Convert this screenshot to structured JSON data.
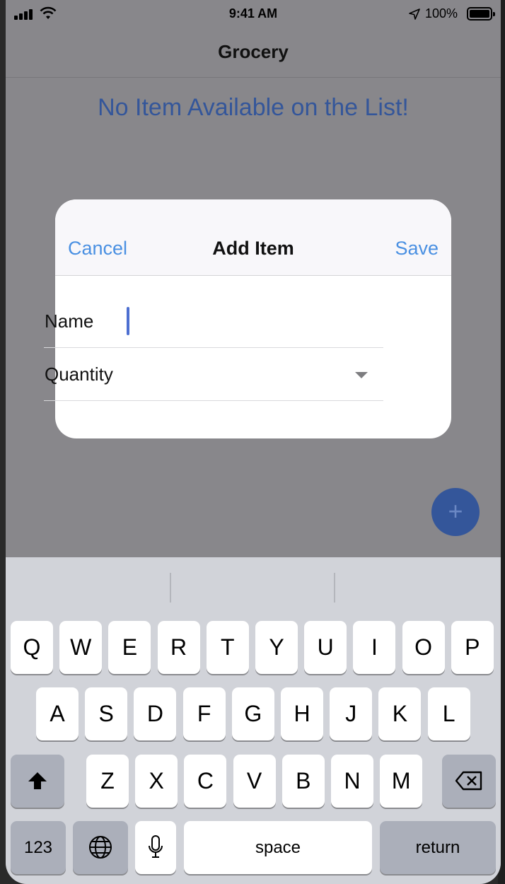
{
  "status_bar": {
    "time": "9:41 AM",
    "battery_percent": "100%"
  },
  "nav": {
    "title": "Grocery"
  },
  "empty_message": "No Item Available on the List!",
  "fab": {
    "label": "+"
  },
  "modal": {
    "cancel": "Cancel",
    "title": "Add Item",
    "save": "Save",
    "fields": {
      "name_label": "Name",
      "name_value": "",
      "quantity_label": "Quantity"
    }
  },
  "keyboard": {
    "row1": [
      "Q",
      "W",
      "E",
      "R",
      "T",
      "Y",
      "U",
      "I",
      "O",
      "P"
    ],
    "row2": [
      "A",
      "S",
      "D",
      "F",
      "G",
      "H",
      "J",
      "K",
      "L"
    ],
    "row3": [
      "Z",
      "X",
      "C",
      "V",
      "B",
      "N",
      "M"
    ],
    "numbers_key": "123",
    "space_key": "space",
    "return_key": "return"
  },
  "colors": {
    "accent": "#4a90e2",
    "message": "#34569a",
    "overlay": "#88878b",
    "keyboard_bg": "#d1d3d9"
  }
}
